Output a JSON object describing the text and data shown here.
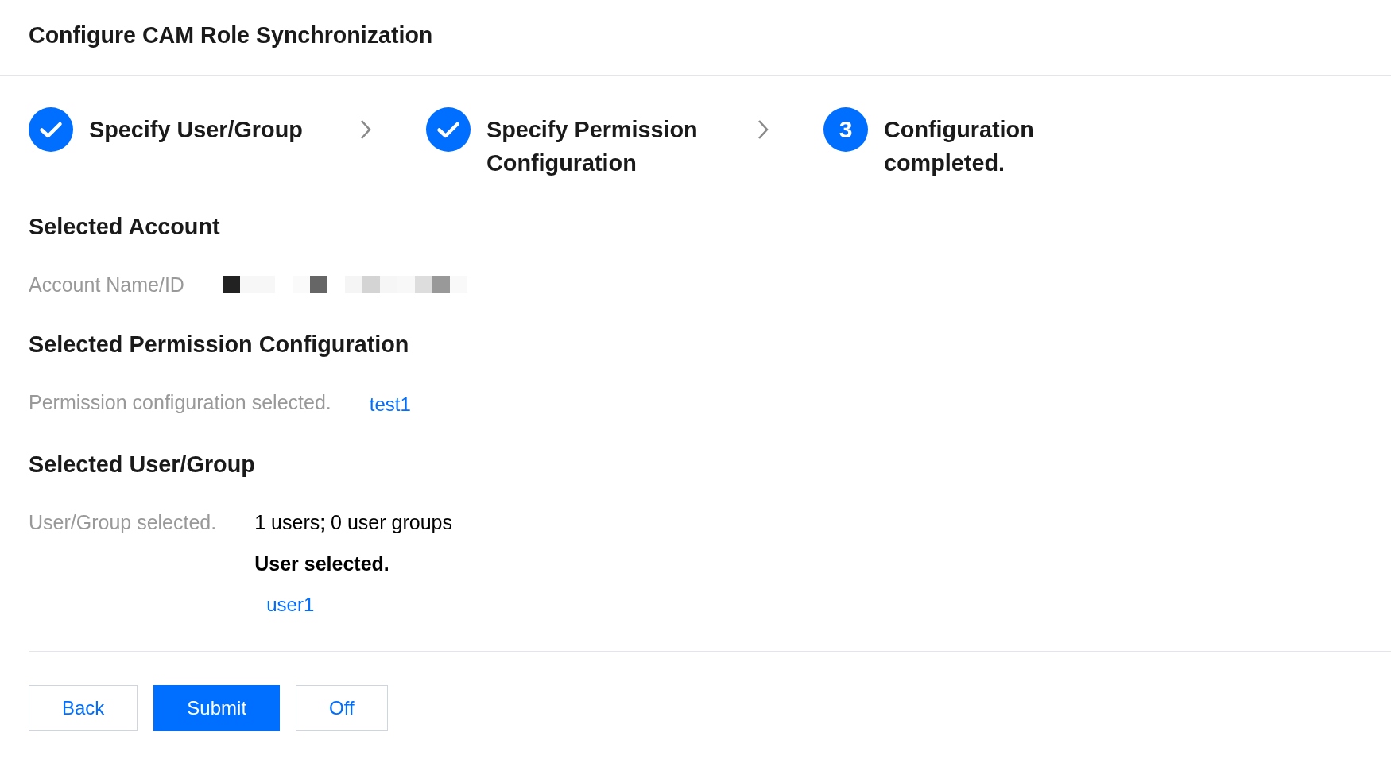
{
  "title": "Configure CAM Role Synchronization",
  "steps": [
    {
      "label": "Specify User/Group",
      "kind": "done"
    },
    {
      "label": "Specify Permission Configuration",
      "kind": "done"
    },
    {
      "label": "Configuration completed.",
      "kind": "current",
      "number": "3"
    }
  ],
  "sections": [
    {
      "heading": "Selected Account",
      "field": {
        "label": "Account Name/ID",
        "kind": "redacted"
      }
    },
    {
      "heading": "Selected Permission Configuration",
      "field": {
        "label": "Permission configuration selected.",
        "kind": "links",
        "links": [
          "test1"
        ]
      }
    },
    {
      "heading": "Selected User/Group",
      "field": {
        "label": "User/Group selected.",
        "kind": "summary",
        "summary": "1 users; 0 user groups",
        "subheading": "User selected.",
        "links": [
          "user1"
        ]
      }
    }
  ],
  "buttons": [
    {
      "label": "Back",
      "kind": "secondary"
    },
    {
      "label": "Submit",
      "kind": "primary"
    },
    {
      "label": "Off",
      "kind": "secondary"
    }
  ]
}
